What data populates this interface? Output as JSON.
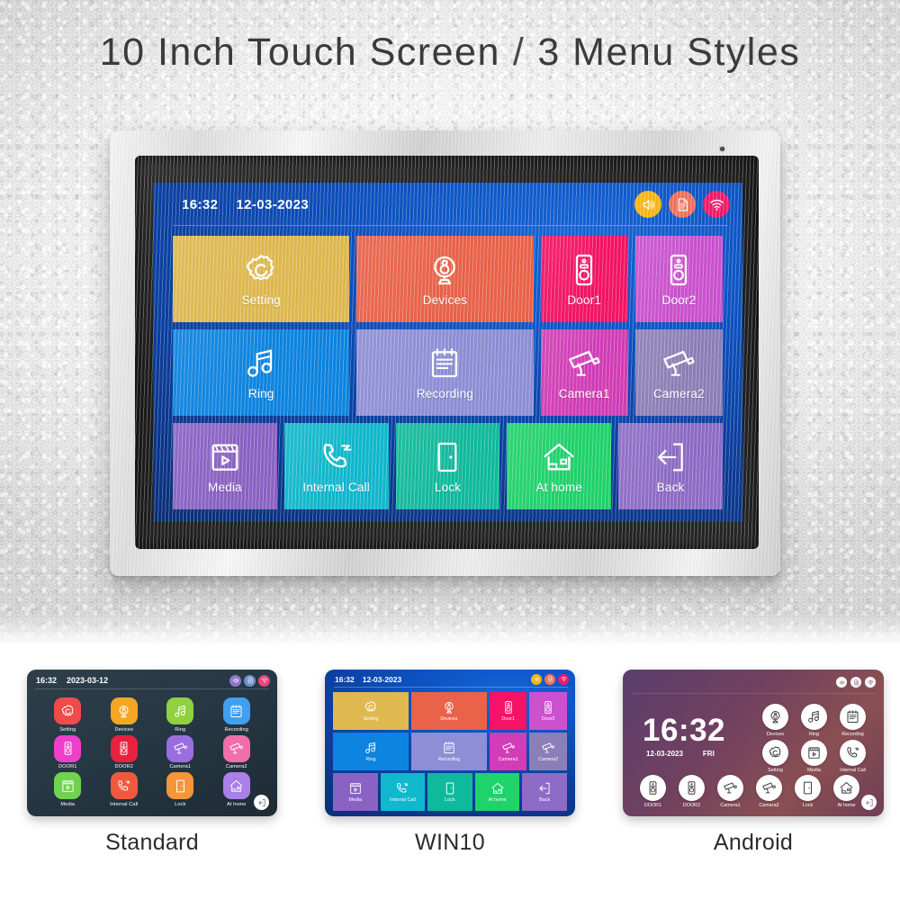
{
  "headline": {
    "left": "10 Inch Touch Screen",
    "separator": "/",
    "right": "3 Menu Styles"
  },
  "device": {
    "status_bar": {
      "time": "16:32",
      "date": "12-03-2023",
      "icons": [
        {
          "name": "volume-icon",
          "color": "#f9b617"
        },
        {
          "name": "document-icon",
          "color": "#f0725c"
        },
        {
          "name": "wifi-icon",
          "color": "#f01b6a"
        }
      ]
    },
    "menu_rows": [
      [
        {
          "label": "Setting",
          "icon": "gear-icon",
          "color": "#dfb84f",
          "span": 2
        },
        {
          "label": "Devices",
          "icon": "webcam-icon",
          "color": "#ea6249",
          "span": 2
        },
        {
          "label": "Door1",
          "icon": "door-station-icon",
          "color": "#f41364",
          "span": 1
        },
        {
          "label": "Door2",
          "icon": "door-station-icon",
          "color": "#cb51cf",
          "span": 1
        }
      ],
      [
        {
          "label": "Ring",
          "icon": "music-note-icon",
          "color": "#0c84e0",
          "span": 2
        },
        {
          "label": "Recording",
          "icon": "notepad-icon",
          "color": "#8d8ed6",
          "span": 2
        },
        {
          "label": "Camera1",
          "icon": "cctv-icon",
          "color": "#d23cb6",
          "span": 1
        },
        {
          "label": "Camera2",
          "icon": "cctv-icon",
          "color": "#8b7fb7",
          "span": 1
        }
      ],
      [
        {
          "label": "Media",
          "icon": "media-icon",
          "color": "#8a62c4",
          "span": 1
        },
        {
          "label": "Internal Call",
          "icon": "phone-call-icon",
          "color": "#0fb8cd",
          "span": 1
        },
        {
          "label": "Lock",
          "icon": "door-lock-icon",
          "color": "#0fba9c",
          "span": 1
        },
        {
          "label": "At home",
          "icon": "home-icon",
          "color": "#1fd36b",
          "span": 1
        },
        {
          "label": "Back",
          "icon": "back-arrow-icon",
          "color": "#8d6bc6",
          "span": 1
        }
      ]
    ]
  },
  "variants": [
    {
      "caption": "Standard",
      "style": "standard",
      "status_bar": {
        "time": "16:32",
        "date": "2023-03-12",
        "icons": [
          {
            "name": "volume-icon",
            "color": "#8f78c8"
          },
          {
            "name": "document-icon",
            "color": "#6f8ec8"
          },
          {
            "name": "wifi-icon",
            "color": "#e8437a"
          }
        ]
      },
      "items": [
        {
          "label": "Setting",
          "icon": "gear-icon",
          "color": "#f04a4a"
        },
        {
          "label": "Devices",
          "icon": "webcam-icon",
          "color": "#f5a623"
        },
        {
          "label": "Ring",
          "icon": "music-note-icon",
          "color": "#8fd13f"
        },
        {
          "label": "Recording",
          "icon": "notepad-icon",
          "color": "#3f9ff0"
        },
        {
          "label": "DOOR1",
          "icon": "door-station-icon",
          "color": "#ef3fc9"
        },
        {
          "label": "DOOR2",
          "icon": "door-station-icon",
          "color": "#e8213f"
        },
        {
          "label": "Camera1",
          "icon": "cctv-icon",
          "color": "#9b6ee0"
        },
        {
          "label": "Camera2",
          "icon": "cctv-icon",
          "color": "#f06fa8"
        },
        {
          "label": "Media",
          "icon": "media-icon",
          "color": "#6fd34f"
        },
        {
          "label": "Internal Call",
          "icon": "phone-call-icon",
          "color": "#ef5a3f"
        },
        {
          "label": "Lock",
          "icon": "door-lock-icon",
          "color": "#f5963a"
        },
        {
          "label": "At home",
          "icon": "home-icon",
          "color": "#a97fe8"
        }
      ],
      "back_button": "back-arrow-icon"
    },
    {
      "caption": "WIN10",
      "style": "win10",
      "status_bar": {
        "time": "16:32",
        "date": "12-03-2023",
        "icons": [
          {
            "name": "volume-icon",
            "color": "#f9b617"
          },
          {
            "name": "document-icon",
            "color": "#f0725c"
          },
          {
            "name": "wifi-icon",
            "color": "#f01b6a"
          }
        ]
      }
    },
    {
      "caption": "Android",
      "style": "android",
      "clock": {
        "time": "16:32",
        "date": "12-03-2023",
        "weekday": "FRI"
      },
      "status_icons": [
        {
          "name": "volume-icon"
        },
        {
          "name": "document-icon"
        },
        {
          "name": "wifi-icon"
        }
      ],
      "group_top": [
        {
          "label": "Devices",
          "icon": "webcam-icon"
        },
        {
          "label": "Ring",
          "icon": "music-note-icon"
        },
        {
          "label": "Recording",
          "icon": "notepad-icon"
        },
        {
          "label": "Setting",
          "icon": "gear-icon"
        },
        {
          "label": "Media",
          "icon": "media-icon"
        },
        {
          "label": "Internal Call",
          "icon": "phone-call-icon"
        }
      ],
      "group_bottom": [
        {
          "label": "DOOR1",
          "icon": "door-station-icon"
        },
        {
          "label": "DOOR2",
          "icon": "door-station-icon"
        },
        {
          "label": "Camera1",
          "icon": "cctv-icon"
        },
        {
          "label": "Camera2",
          "icon": "cctv-icon"
        },
        {
          "label": "Lock",
          "icon": "door-lock-icon"
        },
        {
          "label": "At home",
          "icon": "home-icon"
        }
      ],
      "back_button": "back-arrow-icon"
    }
  ]
}
